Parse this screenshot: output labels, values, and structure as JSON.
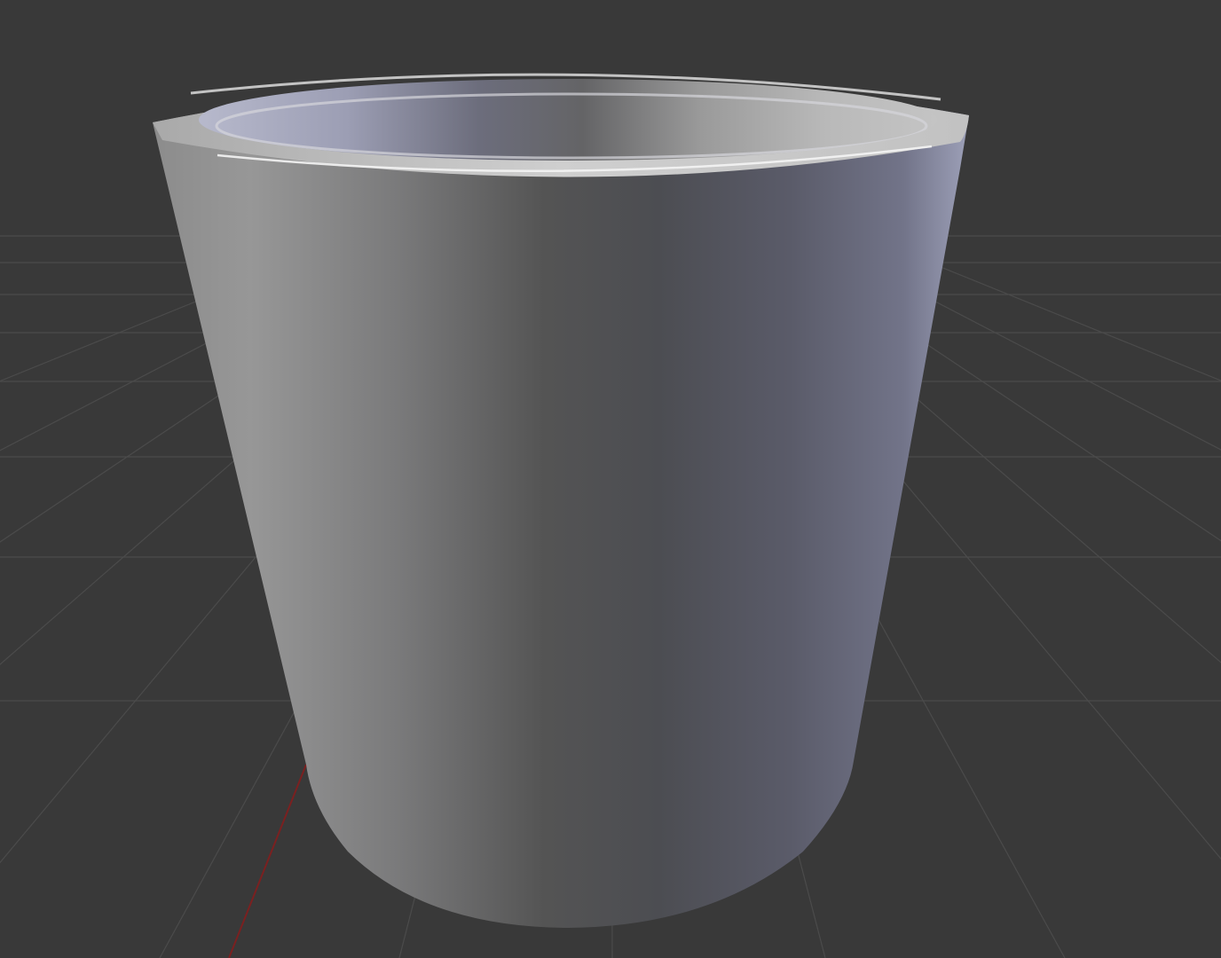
{
  "viewport": {
    "background_color": "#393939",
    "grid_line_color": "#4b4b4b",
    "x_axis_color": "#7a1e1e",
    "object": {
      "type": "cup",
      "shading": "smooth",
      "base_color": "#8e8f98",
      "highlight_color": "#c9cad4",
      "rim_light_color": "#f2f2f2"
    }
  }
}
